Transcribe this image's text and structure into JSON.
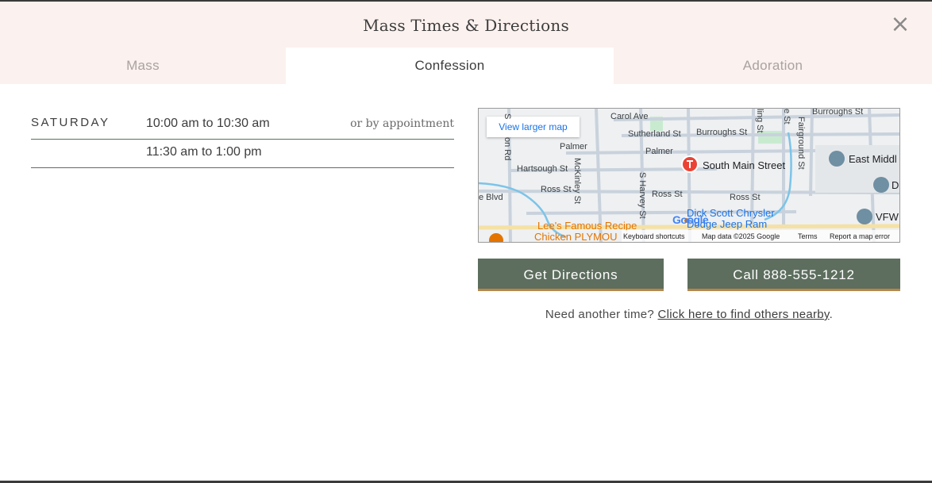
{
  "modal": {
    "title": "Mass Times & Directions",
    "close_label": "×"
  },
  "tabs": [
    {
      "label": "Mass",
      "active": false
    },
    {
      "label": "Confession",
      "active": true
    },
    {
      "label": "Adoration",
      "active": false
    }
  ],
  "schedule": {
    "rows": [
      {
        "day": "SATURDAY",
        "time": "10:00 am to 10:30 am",
        "note": "or by appointment"
      },
      {
        "day": "",
        "time": "11:30 am to 1:00 pm",
        "note": ""
      }
    ]
  },
  "map": {
    "view_larger_label": "View larger map",
    "marker_label": "South Main Street",
    "streets": {
      "carol": "Carol Ave",
      "sutherland": "Sutherland St",
      "burroughs_mid": "Burroughs St",
      "burroughs_top": "Burroughs St",
      "palmer1": "Palmer",
      "palmer2": "Palmer",
      "hartsough": "Hartsough St",
      "ross1": "Ross St",
      "ross2": "Ross St",
      "ross3": "Ross St",
      "mckinley": "McKinley St",
      "harvey": "S Harvey St",
      "fairground": "Fairground St",
      "blvd": "e Blvd",
      "on_rd": "on Rd",
      "s_top": "S",
      "ling": "ling St",
      "e_st": "e St"
    },
    "places": {
      "east_middle": "East Middl",
      "d": "D",
      "vfw": "VFW",
      "dealer_line1": "Dick Scott Chrysler",
      "dealer_line2": "Dodge Jeep Ram",
      "restaurant_line1": "Lee's Famous Recipe",
      "restaurant_line2": "Chicken PLYMOU"
    },
    "google_logo": "Google",
    "footer": {
      "shortcuts": "Keyboard shortcuts",
      "data": "Map data ©2025 Google",
      "terms": "Terms",
      "report": "Report a map error"
    }
  },
  "buttons": {
    "directions": "Get Directions",
    "call": "Call 888-555-1212"
  },
  "nearby": {
    "prefix": "Need another time? ",
    "link": "Click here to find others nearby",
    "suffix": "."
  },
  "colors": {
    "header_bg": "#fbf1ee",
    "button_bg": "#5d6e5e",
    "button_accent": "#b5874a",
    "divider": "#5e6e5f"
  }
}
